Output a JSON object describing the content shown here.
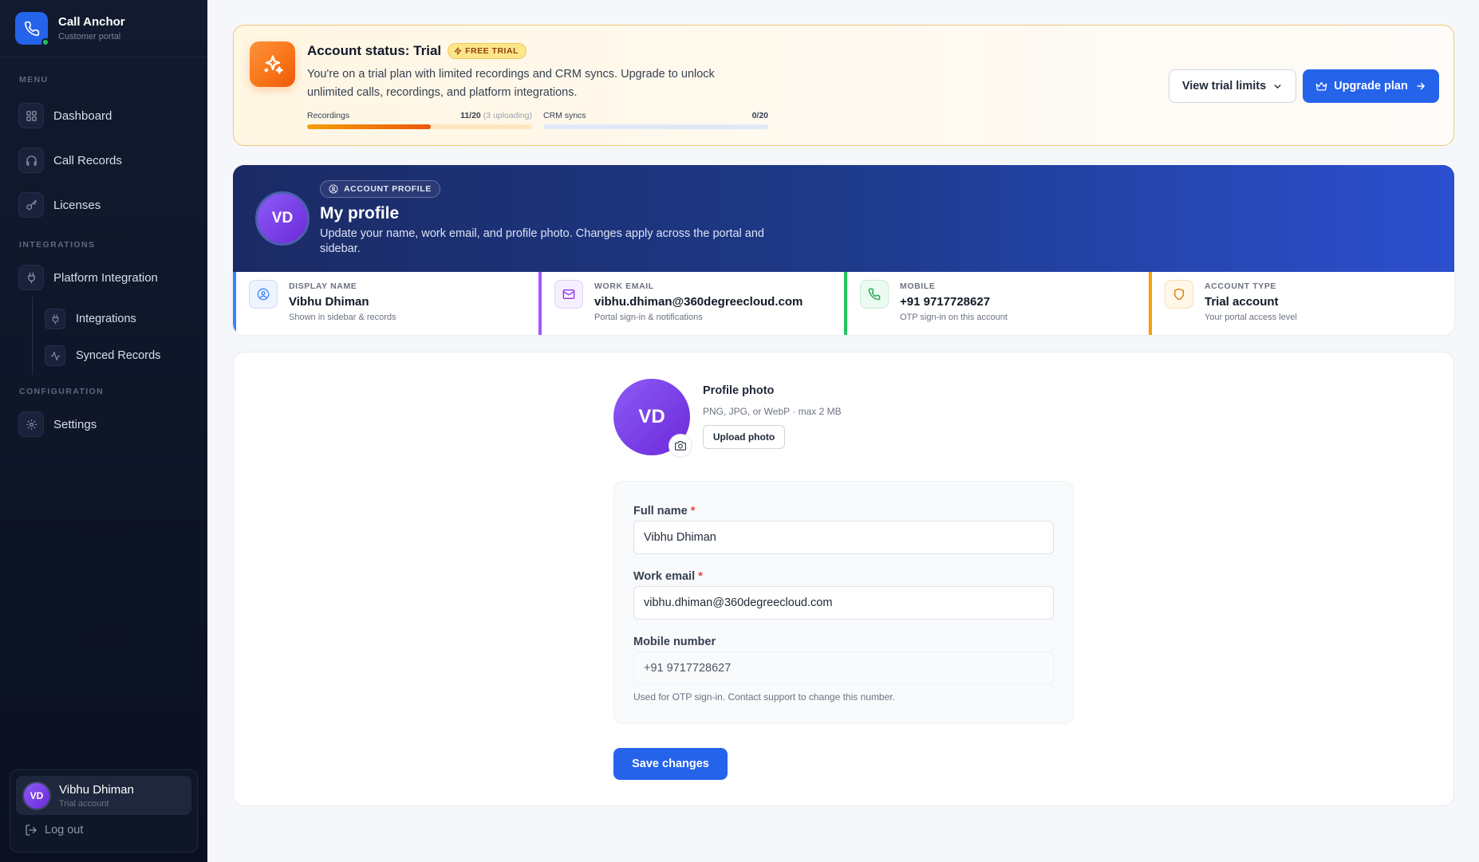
{
  "brand": {
    "name": "Call Anchor",
    "subtitle": "Customer portal"
  },
  "sidebar": {
    "sections": {
      "menu": "MENU",
      "integrations": "INTEGRATIONS",
      "configuration": "CONFIGURATION"
    },
    "items": {
      "dashboard": "Dashboard",
      "call_records": "Call Records",
      "licenses": "Licenses",
      "platform_integration": "Platform Integration",
      "integrations": "Integrations",
      "synced_records": "Synced Records",
      "settings": "Settings"
    },
    "user": {
      "initials": "VD",
      "name": "Vibhu Dhiman",
      "role": "Trial account"
    },
    "logout": "Log out"
  },
  "trial": {
    "title": "Account status: Trial",
    "badge": "FREE TRIAL",
    "description": "You're on a trial plan with limited recordings and CRM syncs. Upgrade to unlock unlimited calls, recordings, and platform integrations.",
    "recordings": {
      "label": "Recordings",
      "count": "11/20",
      "note": "(3 uploading)",
      "used": 11,
      "limit": 20
    },
    "crm": {
      "label": "CRM syncs",
      "count": "0/20",
      "used": 0,
      "limit": 20
    },
    "view_limits": "View trial limits",
    "upgrade": "Upgrade plan"
  },
  "profile": {
    "badge": "ACCOUNT PROFILE",
    "initials": "VD",
    "title": "My profile",
    "description": "Update your name, work email, and profile photo. Changes apply across the portal and sidebar.",
    "stats": {
      "display_name": {
        "label": "DISPLAY NAME",
        "value": "Vibhu Dhiman",
        "note": "Shown in sidebar & records"
      },
      "work_email": {
        "label": "WORK EMAIL",
        "value": "vibhu.dhiman@360degreecloud.com",
        "note": "Portal sign-in & notifications"
      },
      "mobile": {
        "label": "MOBILE",
        "value": "+91 9717728627",
        "note": "OTP sign-in on this account"
      },
      "account_type": {
        "label": "ACCOUNT TYPE",
        "value": "Trial account",
        "note": "Your portal access level"
      }
    }
  },
  "form": {
    "photo": {
      "initials": "VD",
      "title": "Profile photo",
      "hint": "PNG, JPG, or WebP · max 2 MB",
      "upload": "Upload photo"
    },
    "full_name": {
      "label": "Full name",
      "required": "*",
      "value": "Vibhu Dhiman"
    },
    "work_email": {
      "label": "Work email",
      "required": "*",
      "value": "vibhu.dhiman@360degreecloud.com"
    },
    "mobile": {
      "label": "Mobile number",
      "value": "+91 9717728627",
      "help": "Used for OTP sign-in. Contact support to change this number."
    },
    "save": "Save changes"
  },
  "colors": {
    "primary": "#2563eb",
    "trial_accent": "#f97316",
    "violet": "#7c3aed",
    "green": "#16a34a",
    "amber": "#f59e0b"
  }
}
